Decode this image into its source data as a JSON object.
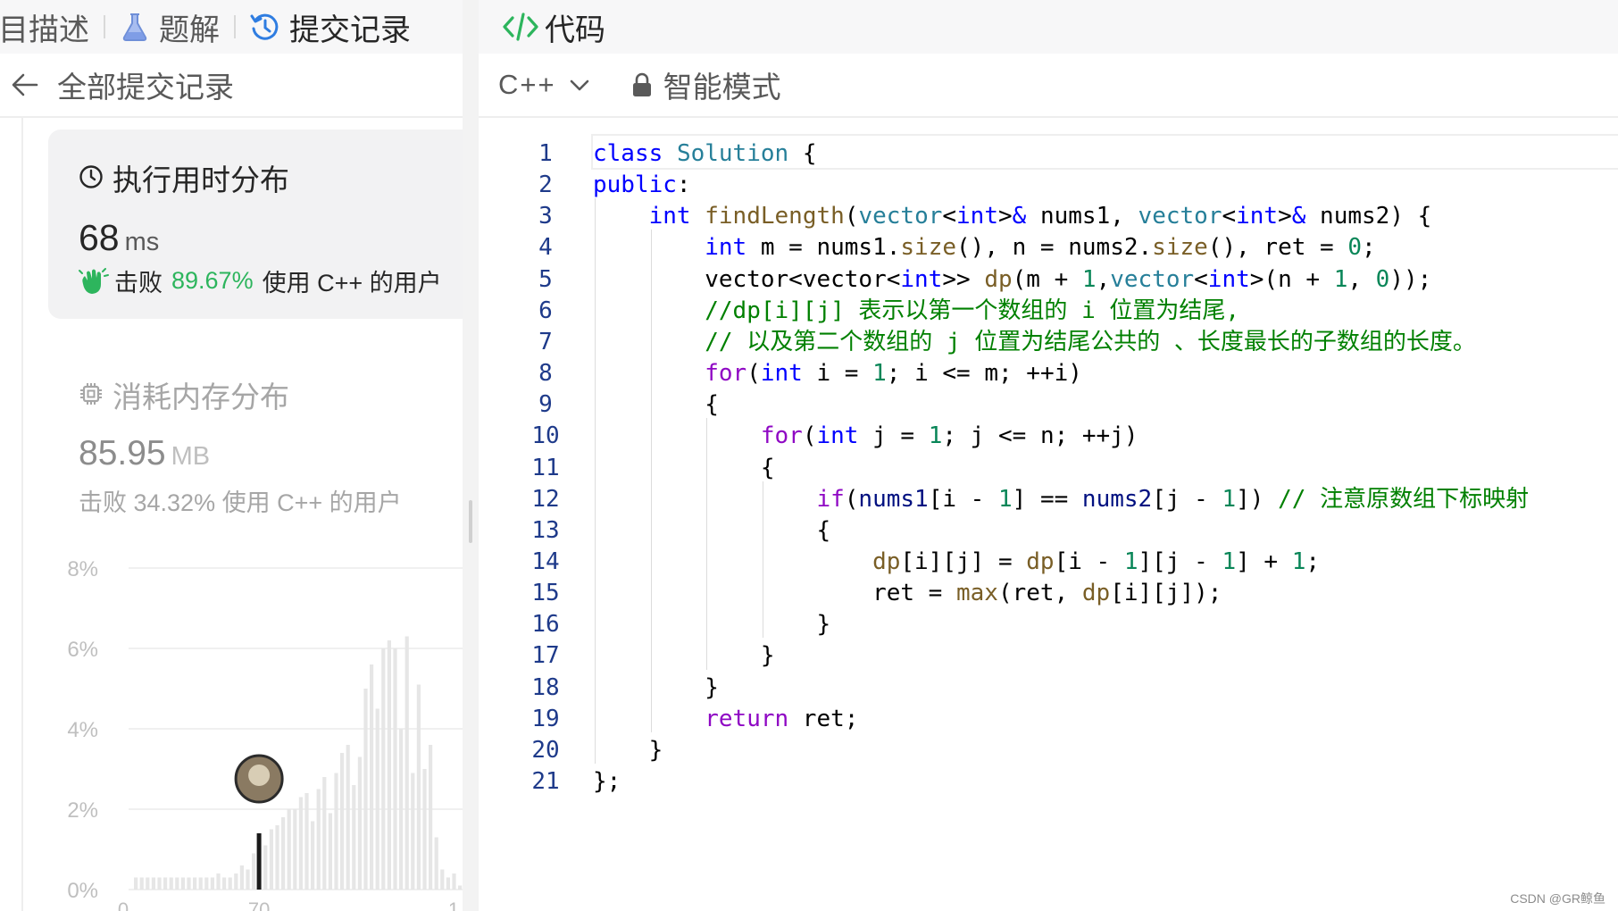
{
  "left_tabs": [
    {
      "label": "目描述",
      "icon": "doc-icon",
      "active": false
    },
    {
      "label": "题解",
      "icon": "flask-icon",
      "active": false
    },
    {
      "label": "提交记录",
      "icon": "history-icon",
      "active": true
    }
  ],
  "sub_header": {
    "title": "全部提交记录",
    "back_icon": "arrow-left-icon"
  },
  "runtime": {
    "heading": "执行用时分布",
    "value": "68",
    "unit": "ms",
    "beat_prefix": "击败",
    "beat_pct": "89.67%",
    "beat_suffix": "使用 C++ 的用户",
    "accent": "#2db55d"
  },
  "memory": {
    "heading": "消耗内存分布",
    "value": "85.95",
    "unit": "MB",
    "beat_text": "击败 34.32% 使用 C++ 的用户"
  },
  "chart_data": {
    "type": "bar",
    "y_ticks": [
      "8%",
      "6%",
      "4%",
      "2%",
      "0%"
    ],
    "ylim": [
      0,
      8
    ],
    "x_ticks": [
      "0",
      "70",
      "1"
    ],
    "values": [
      0.3,
      0.3,
      0.3,
      0.3,
      0.3,
      0.3,
      0.3,
      0.3,
      0.3,
      0.3,
      0.3,
      0.3,
      0.3,
      0.3,
      0.4,
      0.3,
      0.3,
      0.4,
      0.6,
      0.5,
      0.9,
      1.4,
      1.1,
      1.5,
      1.6,
      1.8,
      2.0,
      2.0,
      2.3,
      2.4,
      1.7,
      2.5,
      2.8,
      1.9,
      2.9,
      3.4,
      3.6,
      2.6,
      3.3,
      5.0,
      5.6,
      4.5,
      6.0,
      6.2,
      6.0,
      4.0,
      6.3,
      2.9,
      5.1,
      3.0,
      3.6,
      1.3,
      0.5,
      0.3,
      0.4,
      0.1
    ],
    "highlight_value": 68,
    "highlight_index": 21,
    "grid": true
  },
  "code_panel": {
    "tab_label": "代码",
    "tab_icon": "code-icon",
    "language": "C++",
    "mode_label": "智能模式"
  },
  "code_lines": [
    "class Solution {",
    "public:",
    "    int findLength(vector<int>& nums1, vector<int>& nums2) {",
    "        int m = nums1.size(), n = nums2.size(), ret = 0;",
    "        vector<vector<int>> dp(m + 1,vector<int>(n + 1, 0));",
    "        //dp[i][j] 表示以第一个数组的 i 位置为结尾,",
    "        // 以及第二个数组的 j 位置为结尾公共的 、长度最长的子数组的长度。",
    "        for(int i = 1; i <= m; ++i)",
    "        {",
    "            for(int j = 1; j <= n; ++j)",
    "            {",
    "                if(nums1[i - 1] == nums2[j - 1]) // 注意原数组下标映射",
    "                {",
    "                    dp[i][j] = dp[i - 1][j - 1] + 1;",
    "                    ret = max(ret, dp[i][j]);",
    "                }",
    "            }",
    "        }",
    "        return ret;",
    "    }",
    "};"
  ],
  "watermark": "CSDN @GR鲸鱼"
}
